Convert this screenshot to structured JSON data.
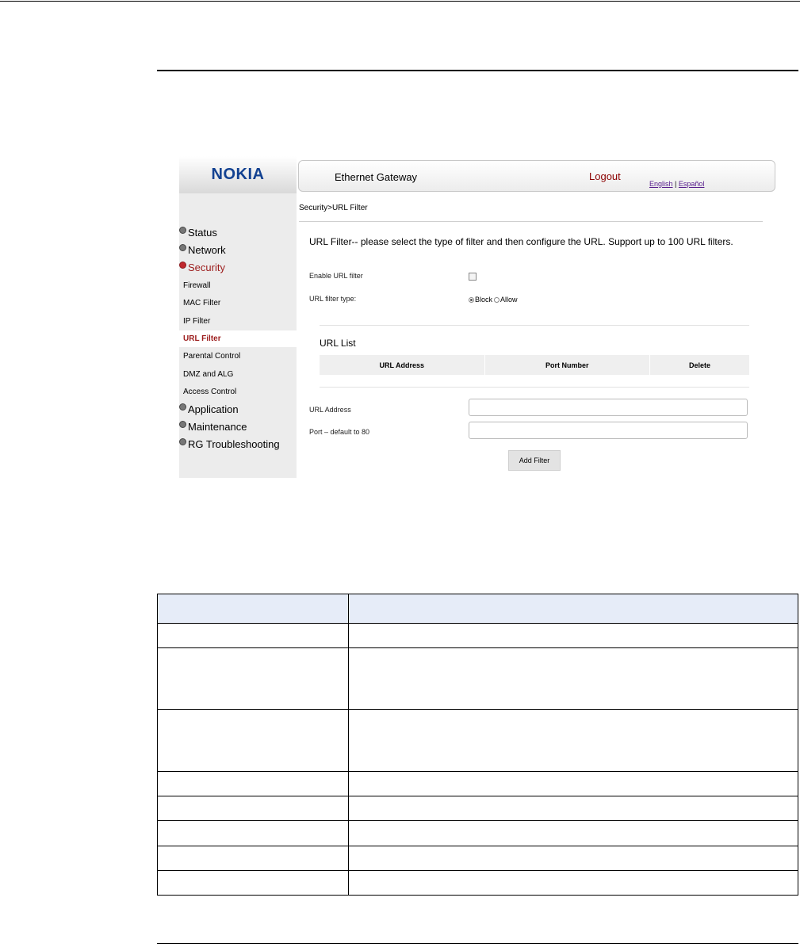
{
  "screenshot": {
    "logo": "NOKIA",
    "topbar": {
      "title": "Ethernet Gateway",
      "logout": "Logout",
      "lang_english": "English",
      "lang_sep": "|",
      "lang_espanol": "Español"
    },
    "sidebar": {
      "items": [
        {
          "label": "Status"
        },
        {
          "label": "Network"
        },
        {
          "label": "Security"
        },
        {
          "label": "Firewall"
        },
        {
          "label": "MAC Filter"
        },
        {
          "label": "IP Filter"
        },
        {
          "label": "URL Filter"
        },
        {
          "label": "Parental Control"
        },
        {
          "label": "DMZ and ALG"
        },
        {
          "label": "Access Control"
        },
        {
          "label": "Application"
        },
        {
          "label": "Maintenance"
        },
        {
          "label": "RG Troubleshooting"
        }
      ]
    },
    "breadcrumb": "Security>URL Filter",
    "intro": "URL Filter-- please select the type of filter and then configure the URL. Support up to 100 URL filters.",
    "enable_label": "Enable URL filter",
    "enable_checked": false,
    "type_label": "URL filter type:",
    "type_options": [
      "Block",
      "Allow"
    ],
    "type_selected": "Block",
    "url_list_title": "URL List",
    "table_headers": [
      "URL Address",
      "Port Number",
      "Delete"
    ],
    "url_address_label": "URL Address",
    "url_address_value": "",
    "port_label": "Port – default to 80",
    "port_value": "",
    "add_button": "Add Filter"
  },
  "description_table": {
    "rows": [
      [
        "",
        ""
      ],
      [
        "",
        ""
      ],
      [
        "",
        ""
      ],
      [
        "",
        ""
      ],
      [
        "",
        ""
      ],
      [
        "",
        ""
      ],
      [
        "",
        ""
      ],
      [
        "",
        ""
      ],
      [
        "",
        ""
      ]
    ]
  }
}
